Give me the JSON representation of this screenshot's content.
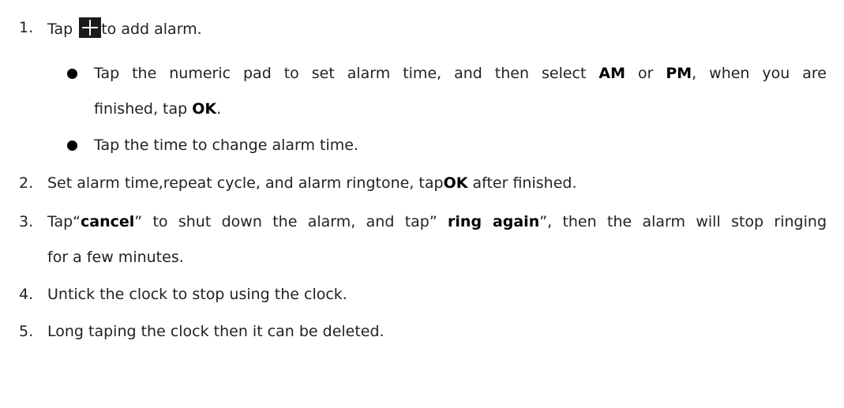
{
  "steps": [
    {
      "number": "1.",
      "before_icon": "Tap ",
      "icon": "plus-icon",
      "after_icon": "to add alarm.",
      "bullets": [
        {
          "line1": {
            "t1": "Tap the numeric pad to set alarm time, and then select ",
            "b1": "AM",
            "t2": " or ",
            "b2": "PM",
            "t3": ", when you are"
          },
          "line2": {
            "t1": "finished, tap ",
            "b1": "OK",
            "t2": "."
          }
        },
        {
          "text": "Tap the time to change alarm time."
        }
      ]
    },
    {
      "number": "2.",
      "t1": "Set alarm time,repeat cycle, and alarm ringtone, tap",
      "b1": "OK",
      "t2": " after finished."
    },
    {
      "number": "3.",
      "line1": {
        "t1": "Tap“",
        "b1": "cancel",
        "t2": "” to shut down the alarm, and tap” ",
        "b2": "ring again",
        "t3": "”, then the alarm will stop ringing"
      },
      "line2": "for a few minutes."
    },
    {
      "number": "4.",
      "text": "Untick the clock to stop using the clock."
    },
    {
      "number": "5.",
      "text": "Long taping the clock then it can be deleted."
    }
  ]
}
